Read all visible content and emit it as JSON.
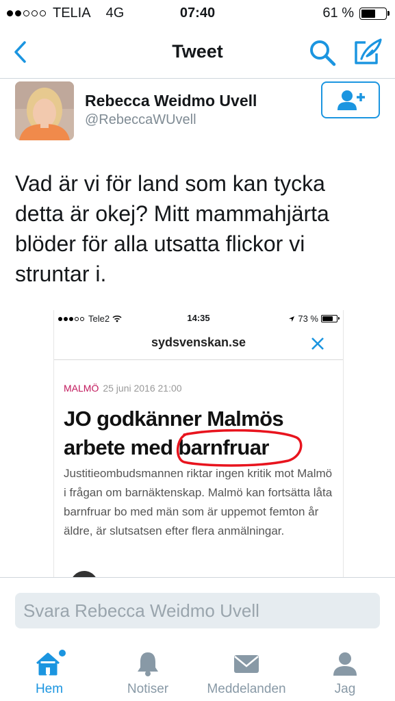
{
  "status_bar": {
    "carrier": "TELIA",
    "network": "4G",
    "time": "07:40",
    "battery": "61 %",
    "signal_bars_filled": 2,
    "signal_bars_total": 5
  },
  "nav": {
    "title": "Tweet",
    "back_icon": "chevron-left-icon",
    "search_icon": "search-icon",
    "compose_icon": "compose-icon",
    "accent": "#1b95e0"
  },
  "tweet": {
    "author_name": "Rebecca Weidmo Uvell",
    "author_handle": "@RebeccaWUvell",
    "text": "Vad är vi för land som kan tycka detta är okej? Mitt mammahjärta blöder för alla utsatta flickor vi struntar i.",
    "follow_icon": "follow-user-icon"
  },
  "media": {
    "status": {
      "carrier": "Tele2",
      "time": "14:35",
      "battery": "73 %"
    },
    "url": "sydsvenskan.se",
    "section": "MALMÖ",
    "date": "25 juni 2016 21:00",
    "headline": "JO godkänner Malmös arbete med barnfruar",
    "body": "Justitieombudsmannen riktar ingen kritik mot Malmö i frågan om barnäktenskap. Malmö kan fortsätta låta barnfruar bo med män som är uppemot femton år äldre, är slutsatsen efter flera anmälningar.",
    "section_color": "#c1175b",
    "annotation_color": "#e8141e"
  },
  "reply": {
    "placeholder": "Svara Rebecca Weidmo Uvell"
  },
  "tabs": [
    {
      "label": "Hem",
      "icon": "home-icon",
      "active": true,
      "notification_dot": true
    },
    {
      "label": "Notiser",
      "icon": "bell-icon",
      "active": false
    },
    {
      "label": "Meddelanden",
      "icon": "envelope-icon",
      "active": false
    },
    {
      "label": "Jag",
      "icon": "person-icon",
      "active": false
    }
  ]
}
